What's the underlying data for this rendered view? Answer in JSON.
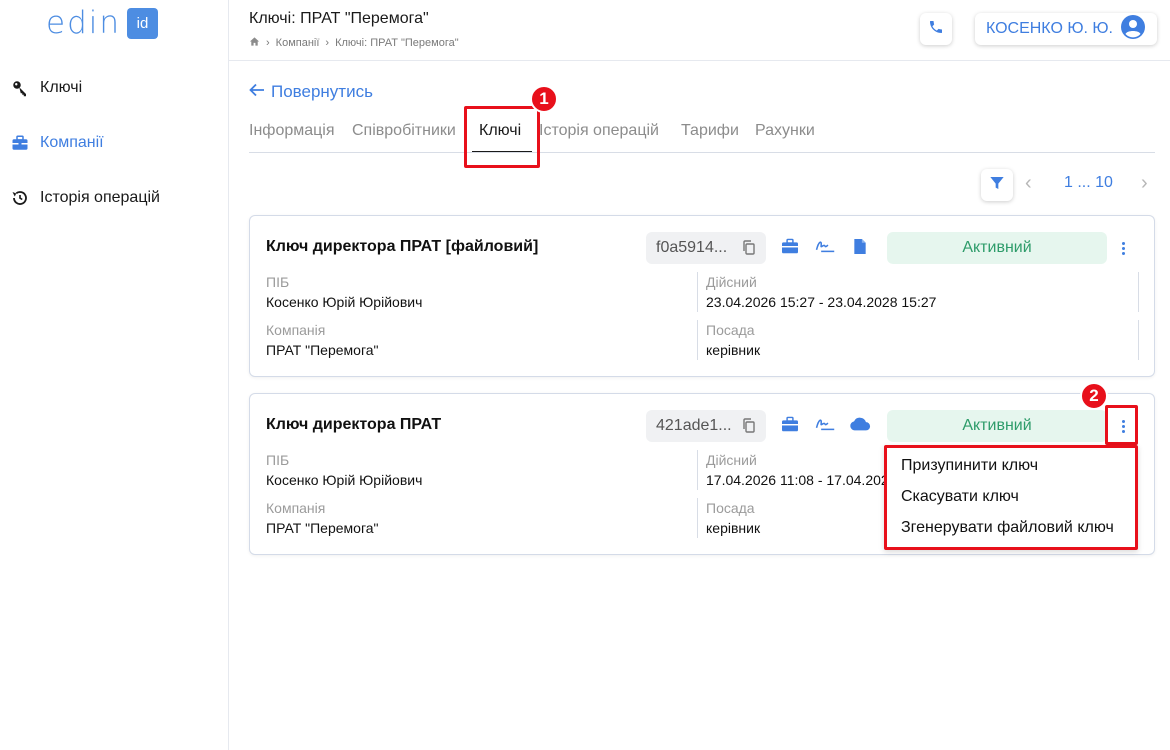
{
  "logo": {
    "text": "edin",
    "badge": "id"
  },
  "sidebar": {
    "items": [
      {
        "label": "Ключі",
        "icon": "key-icon"
      },
      {
        "label": "Компанії",
        "icon": "briefcase-icon",
        "active": true
      },
      {
        "label": "Історія операцій",
        "icon": "history-icon"
      }
    ]
  },
  "header": {
    "title": "Ключі: ПРАТ \"Перемога\"",
    "breadcrumb": [
      "Компанії",
      "Ключі: ПРАТ \"Перемога\""
    ],
    "user": "КОСЕНКО Ю. Ю."
  },
  "back_label": "Повернутись",
  "tabs": [
    "Інформація",
    "Співробітники",
    "Ключі",
    "Історія операцій",
    "Тарифи",
    "Рахунки"
  ],
  "pagination": {
    "text": "1 ... 10"
  },
  "annotations": {
    "one": "1",
    "two": "2"
  },
  "colors": {
    "accent": "#3f7ee0",
    "highlight": "#e8101b",
    "status_bg": "#e6f6ee",
    "status_text": "#2e9c6a"
  },
  "cards": [
    {
      "title": "Ключ директора ПРАТ [файловий]",
      "id": "f0a5914...",
      "status": "Активний",
      "storage_icon": "file-icon",
      "pib_label": "ПІБ",
      "pib": "Косенко Юрій Юрійович",
      "valid_label": "Дійсний",
      "valid": "23.04.2026 15:27 - 23.04.2028 15:27",
      "company_label": "Компанія",
      "company": "ПРАТ \"Перемога\"",
      "position_label": "Посада",
      "position": "керівник"
    },
    {
      "title": "Ключ директора ПРАТ",
      "id": "421ade1...",
      "status": "Активний",
      "storage_icon": "cloud-icon",
      "pib_label": "ПІБ",
      "pib": "Косенко Юрій Юрійович",
      "valid_label": "Дійсний",
      "valid": "17.04.2026 11:08 - 17.04.202",
      "company_label": "Компанія",
      "company": "ПРАТ \"Перемога\"",
      "position_label": "Посада",
      "position": "керівник"
    }
  ],
  "context_menu": [
    "Призупинити ключ",
    "Скасувати ключ",
    "Згенерувати файловий ключ"
  ]
}
